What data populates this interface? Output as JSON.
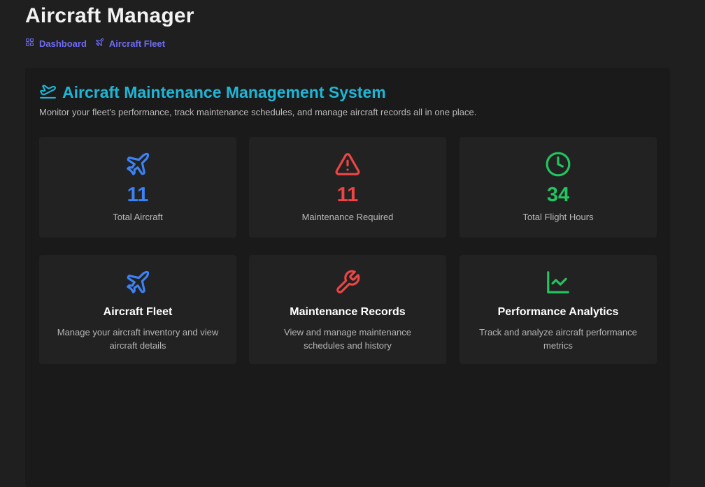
{
  "app": {
    "title": "Aircraft Manager"
  },
  "breadcrumb": [
    {
      "label": "Dashboard",
      "icon": "grid-icon"
    },
    {
      "label": "Aircraft Fleet",
      "icon": "plane-icon"
    }
  ],
  "header": {
    "title": "Aircraft Maintenance Management System",
    "subtitle": "Monitor your fleet's performance, track maintenance schedules, and manage aircraft records all in one place.",
    "icon": "plane-takeoff-icon",
    "color": "#1fb6d6"
  },
  "stats": [
    {
      "value": "11",
      "label": "Total Aircraft",
      "icon": "plane-icon",
      "color": "#3b82f6"
    },
    {
      "value": "11",
      "label": "Maintenance Required",
      "icon": "alert-triangle-icon",
      "color": "#ef4444"
    },
    {
      "value": "34",
      "label": "Total Flight Hours",
      "icon": "clock-icon",
      "color": "#22c55e"
    }
  ],
  "features": [
    {
      "title": "Aircraft Fleet",
      "description": "Manage your aircraft inventory and view aircraft details",
      "icon": "plane-icon",
      "color": "#3b82f6"
    },
    {
      "title": "Maintenance Records",
      "description": "View and manage maintenance schedules and history",
      "icon": "wrench-icon",
      "color": "#ef4444"
    },
    {
      "title": "Performance Analytics",
      "description": "Track and analyze aircraft performance metrics",
      "icon": "line-chart-icon",
      "color": "#22c55e"
    }
  ],
  "colors": {
    "link": "#6f6cf5",
    "background": "#1f1f1f",
    "panel": "#1a1a1a",
    "card": "#222222"
  }
}
